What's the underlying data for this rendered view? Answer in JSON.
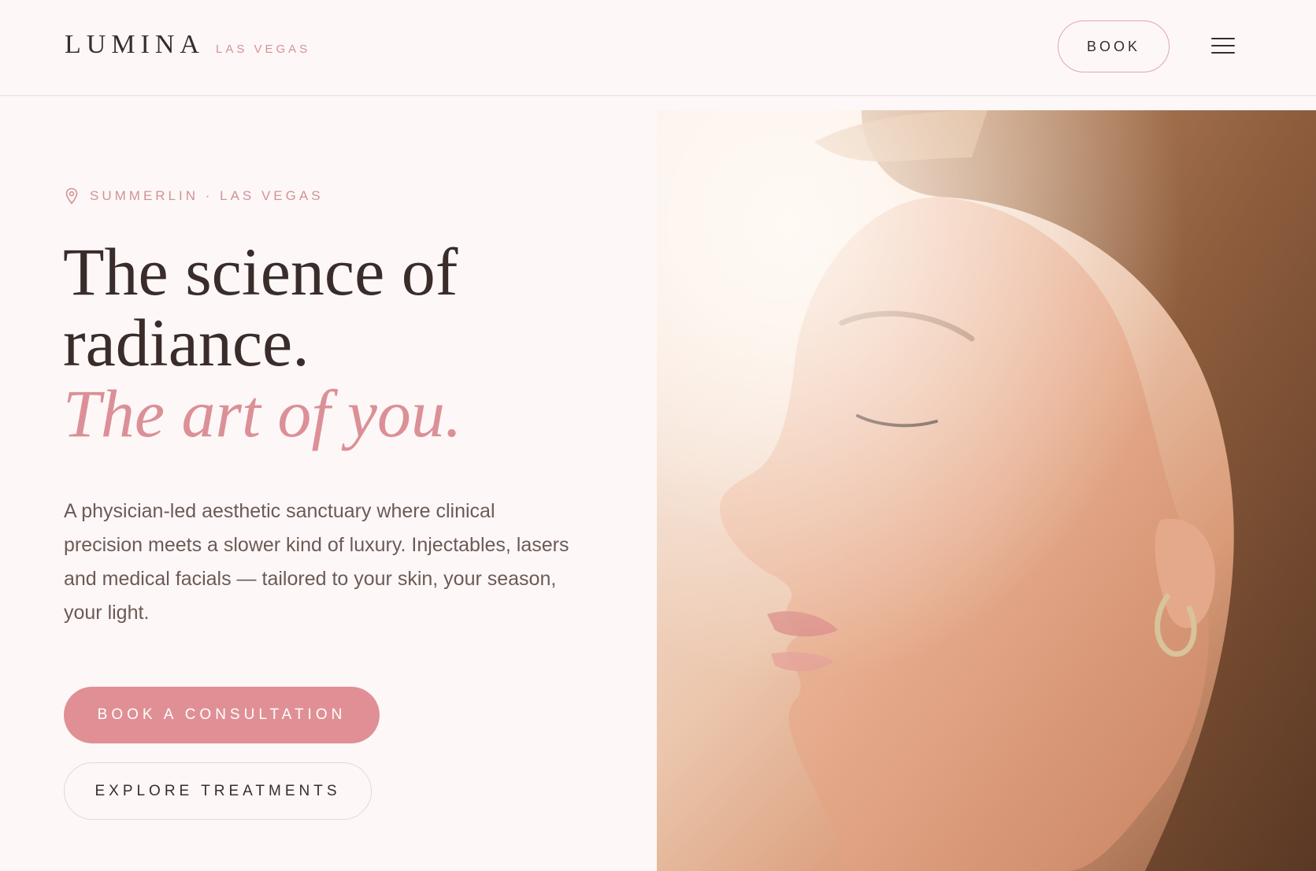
{
  "header": {
    "brand_name": "LUMINA",
    "brand_location": "LAS VEGAS",
    "book_label": "BOOK",
    "menu_icon": "hamburger-menu-icon"
  },
  "hero": {
    "location_icon": "map-pin-icon",
    "location_label": "SUMMERLIN · LAS VEGAS",
    "headline_line1": "The science of",
    "headline_line2": "radiance.",
    "headline_accent": "The art of you.",
    "lede": "A physician-led aesthetic sanctuary where clinical precision meets a slower kind of luxury. Injectables, lasers and medical facials — tailored to your skin, your season, your light.",
    "primary_cta": "BOOK A CONSULTATION",
    "secondary_cta": "EXPLORE TREATMENTS",
    "image_subject": "woman-profile-portrait"
  },
  "colors": {
    "background": "#fdf8f7",
    "accent": "#db9097",
    "primary_button": "#e09095",
    "text_dark": "#3a2c2a",
    "text_body": "#6c5a57"
  }
}
